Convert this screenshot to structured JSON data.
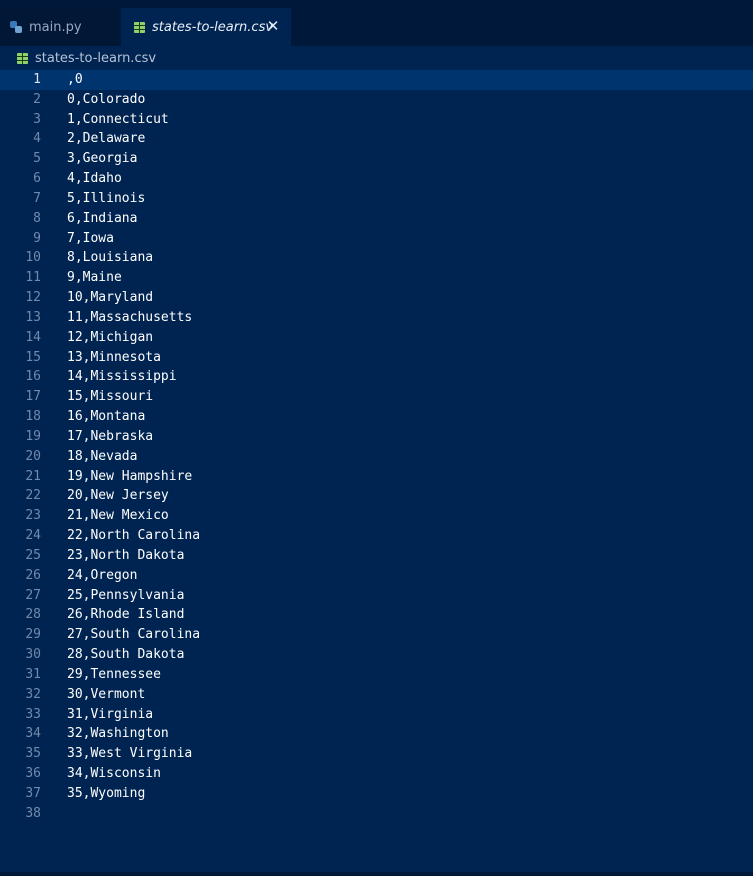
{
  "tabs": [
    {
      "label": "main.py",
      "icon": "python-file-icon",
      "active": false
    },
    {
      "label": "states-to-learn.csv",
      "icon": "csv-file-icon",
      "active": true
    }
  ],
  "close_glyph": "✕",
  "breadcrumb": {
    "label": "states-to-learn.csv",
    "icon": "csv-file-icon"
  },
  "editor": {
    "line_numbers": [
      "1",
      "2",
      "3",
      "4",
      "5",
      "6",
      "7",
      "8",
      "9",
      "10",
      "11",
      "12",
      "13",
      "14",
      "15",
      "16",
      "17",
      "18",
      "19",
      "20",
      "21",
      "22",
      "23",
      "24",
      "25",
      "26",
      "27",
      "28",
      "29",
      "30",
      "31",
      "32",
      "33",
      "34",
      "35",
      "36",
      "37",
      "38"
    ],
    "lines": [
      ",0",
      "0,Colorado",
      "1,Connecticut",
      "2,Delaware",
      "3,Georgia",
      "4,Idaho",
      "5,Illinois",
      "6,Indiana",
      "7,Iowa",
      "8,Louisiana",
      "9,Maine",
      "10,Maryland",
      "11,Massachusetts",
      "12,Michigan",
      "13,Minnesota",
      "14,Mississippi",
      "15,Missouri",
      "16,Montana",
      "17,Nebraska",
      "18,Nevada",
      "19,New Hampshire",
      "20,New Jersey",
      "21,New Mexico",
      "22,North Carolina",
      "23,North Dakota",
      "24,Oregon",
      "25,Pennsylvania",
      "26,Rhode Island",
      "27,South Carolina",
      "28,South Dakota",
      "29,Tennessee",
      "30,Vermont",
      "31,Virginia",
      "32,Washington",
      "33,West Virginia",
      "34,Wisconsin",
      "35,Wyoming",
      ""
    ],
    "current_line": "1"
  },
  "colors": {
    "editor_bg": "#002451",
    "tabbar_bg": "#00193a",
    "line_highlight": "#00346e",
    "line_number": "#7289ab",
    "text": "#ffffff"
  }
}
